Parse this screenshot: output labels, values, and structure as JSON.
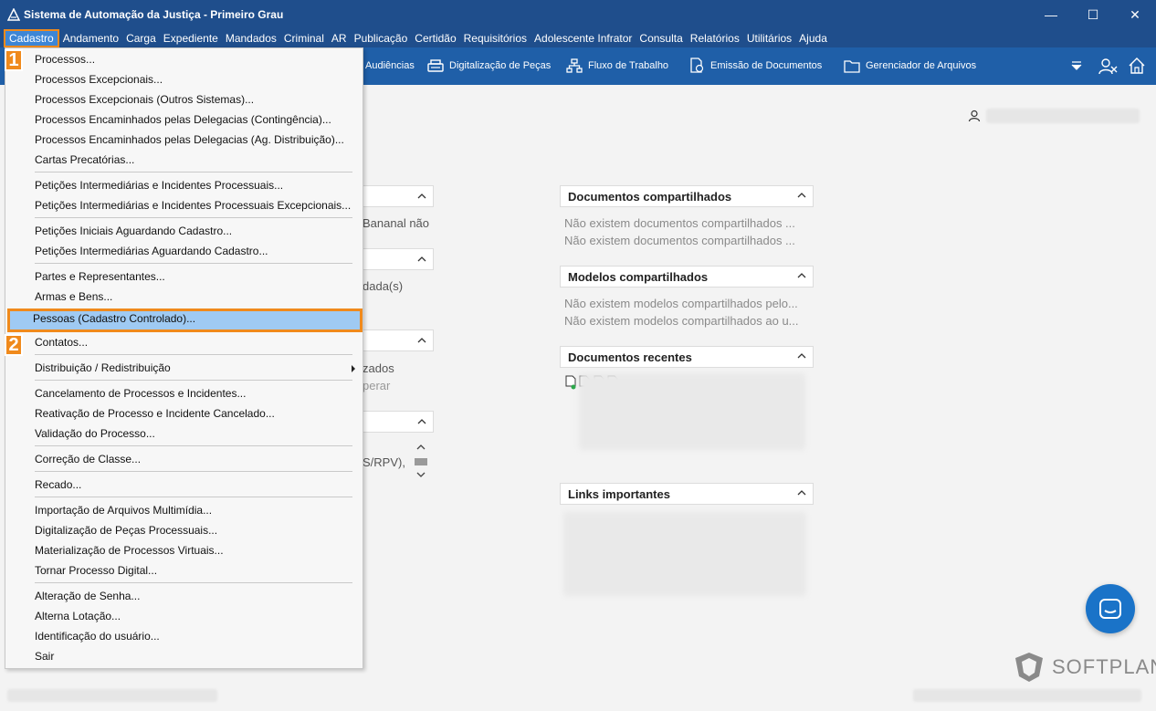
{
  "window": {
    "title": "Sistema de Automação da Justiça - Primeiro Grau",
    "minimize": "—",
    "maximize": "☐",
    "close": "✕"
  },
  "menubar": [
    "Cadastro",
    "Andamento",
    "Carga",
    "Expediente",
    "Mandados",
    "Criminal",
    "AR",
    "Publicação",
    "Certidão",
    "Requisitórios",
    "Adolescente Infrator",
    "Consulta",
    "Relatórios",
    "Utilitários",
    "Ajuda"
  ],
  "toolbar": {
    "audiencias": "Audiências",
    "digitalizacao": "Digitalização de Peças",
    "fluxo": "Fluxo de Trabalho",
    "emissao": "Emissão de Documentos",
    "gerenciador": "Gerenciador de Arquivos"
  },
  "dropdown": [
    "Processos...",
    "Processos Excepcionais...",
    "Processos Excepcionais (Outros Sistemas)...",
    "Processos Encaminhados pelas Delegacias (Contingência)...",
    "Processos Encaminhados pelas Delegacias (Ag. Distribuição)...",
    "Cartas Precatórias...",
    "Petições Intermediárias e Incidentes Processuais...",
    "Petições Intermediárias e Incidentes Processuais Excepcionais...",
    "Petições Iniciais Aguardando Cadastro...",
    "Petições Intermediárias Aguardando Cadastro...",
    "Partes e Representantes...",
    "Armas e Bens...",
    "Pessoas (Cadastro Controlado)...",
    "Contatos...",
    "Distribuição / Redistribuição",
    "Cancelamento de Processos e Incidentes...",
    "Reativação de Processo e Incidente Cancelado...",
    "Validação do Processo...",
    "Correção de Classe...",
    "Recado...",
    "Importação de Arquivos Multimídia...",
    "Digitalização de Peças Processuais...",
    "Materialização de Processos Virtuais...",
    "Tornar Processo Digital...",
    "Alteração de Senha...",
    "Alterna Lotação...",
    "Identificação do usuário...",
    "Sair"
  ],
  "badges": [
    "1",
    "2"
  ],
  "left_fragments": {
    "f1": "Bananal não",
    "f2": "dada(s)",
    "f3": "zados",
    "f4": "perar",
    "f5": "S/RPV),"
  },
  "panels": {
    "docs_shared": {
      "title": "Documentos compartilhados",
      "lines": [
        "Não existem documentos compartilhados ...",
        "Não existem documentos compartilhados ..."
      ]
    },
    "models_shared": {
      "title": "Modelos compartilhados",
      "lines": [
        "Não existem modelos compartilhados pelo...",
        "Não existem modelos compartilhados ao u..."
      ]
    },
    "recent": {
      "title": "Documentos recentes"
    },
    "links": {
      "title": "Links importantes"
    }
  },
  "brand": {
    "name": "SOFTPLAN"
  },
  "colors": {
    "titlebar": "#1f4e8c",
    "toolbar": "#1f5fa8",
    "highlight": "#9fcaf3",
    "accent": "#f08a1c",
    "fab": "#1a73c8"
  }
}
